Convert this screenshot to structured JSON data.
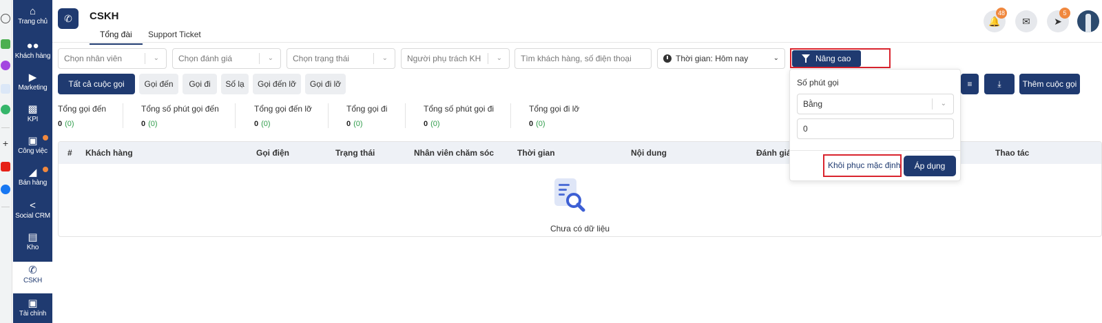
{
  "nav": {
    "items": [
      {
        "icon": "home-icon",
        "label": "Trang chủ"
      },
      {
        "icon": "users-icon",
        "label": "Khách hàng"
      },
      {
        "icon": "megaphone-icon",
        "label": "Marketing"
      },
      {
        "icon": "chart-icon",
        "label": "KPI"
      },
      {
        "icon": "briefcase-icon",
        "label": "Công việc"
      },
      {
        "icon": "cart-icon",
        "label": "Bán hàng"
      },
      {
        "icon": "share-icon",
        "label": "Social CRM"
      },
      {
        "icon": "warehouse-icon",
        "label": "Kho"
      },
      {
        "icon": "phone-icon",
        "label": "CSKH"
      },
      {
        "icon": "wallet-icon",
        "label": "Tài chính"
      }
    ],
    "active": "CSKH",
    "colors": {
      "bg": "#1f3a70",
      "dot": "#f0883e"
    }
  },
  "header": {
    "title": "CSKH",
    "tabs": [
      "Tổng đài",
      "Support Ticket"
    ],
    "notifications_count": "48",
    "rocket_badge": "5"
  },
  "filters": {
    "employee_placeholder": "Chọn nhân viên",
    "rating_placeholder": "Chọn đánh giá",
    "status_placeholder": "Chọn trạng thái",
    "owner_placeholder": "Người phụ trách KH",
    "search_placeholder": "Tìm khách hàng, số điện thoại",
    "time_value": "Thời gian: Hôm nay",
    "advanced_label": "Nâng cao"
  },
  "call_types": [
    "Tất cả cuộc gọi",
    "Gọi đến",
    "Gọi đi",
    "Số lạ",
    "Gọi đến lỡ",
    "Gọi đi lỡ"
  ],
  "actions": {
    "add_call": "Thêm cuộc gọi"
  },
  "stats": [
    {
      "label": "Tổng gọi đến",
      "value": "0",
      "sub": "(0)"
    },
    {
      "label": "Tổng số phút gọi đến",
      "value": "0",
      "sub": "(0)"
    },
    {
      "label": "Tổng gọi đến lỡ",
      "value": "0",
      "sub": "(0)"
    },
    {
      "label": "Tổng gọi đi",
      "value": "0",
      "sub": "(0)"
    },
    {
      "label": "Tổng số phút gọi đi",
      "value": "0",
      "sub": "(0)"
    },
    {
      "label": "Tổng gọi đi lỡ",
      "value": "0",
      "sub": "(0)"
    }
  ],
  "table": {
    "columns": [
      "#",
      "Khách hàng",
      "Gọi điện",
      "Trạng thái",
      "Nhân viên chăm sóc",
      "Thời gian",
      "Nội dung",
      "Đánh giá",
      "Thao tác"
    ],
    "empty_text": "Chưa có dữ liệu"
  },
  "popover": {
    "label": "Số phút gọi",
    "operator": "Bằng",
    "value": "0",
    "reset_label": "Khôi phục mặc định",
    "apply_label": "Áp dụng"
  },
  "colors": {
    "primary": "#1f3a70",
    "badge": "#f0883e",
    "positive": "#2e9c4a",
    "highlight": "#d9232d"
  }
}
